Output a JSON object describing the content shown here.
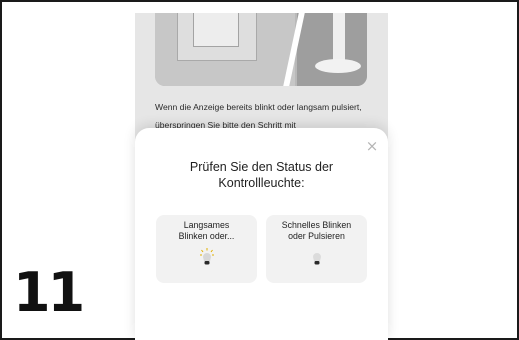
{
  "instruction_text": "Wenn die Anzeige bereits blinkt oder langsam pulsiert, überspringen Sie bitte den Schritt mit",
  "sheet": {
    "title_line1": "Prüfen Sie den Status der",
    "title_line2": "Kontrollleuchte:",
    "close_symbol": "×",
    "options": [
      {
        "line1": "Langsames",
        "line2": "Blinken oder...",
        "icon": "blinking-bulb-icon"
      },
      {
        "line1": "Schnelles Blinken",
        "line2": "oder Pulsieren",
        "icon": "bulb-icon"
      }
    ]
  },
  "step_number": "11",
  "colors": {
    "backdrop": "#e6e6e6",
    "sheet": "#ffffff",
    "option_card": "#f2f2f2",
    "text": "#1f1f1f",
    "close_icon": "#b5b5b5"
  }
}
